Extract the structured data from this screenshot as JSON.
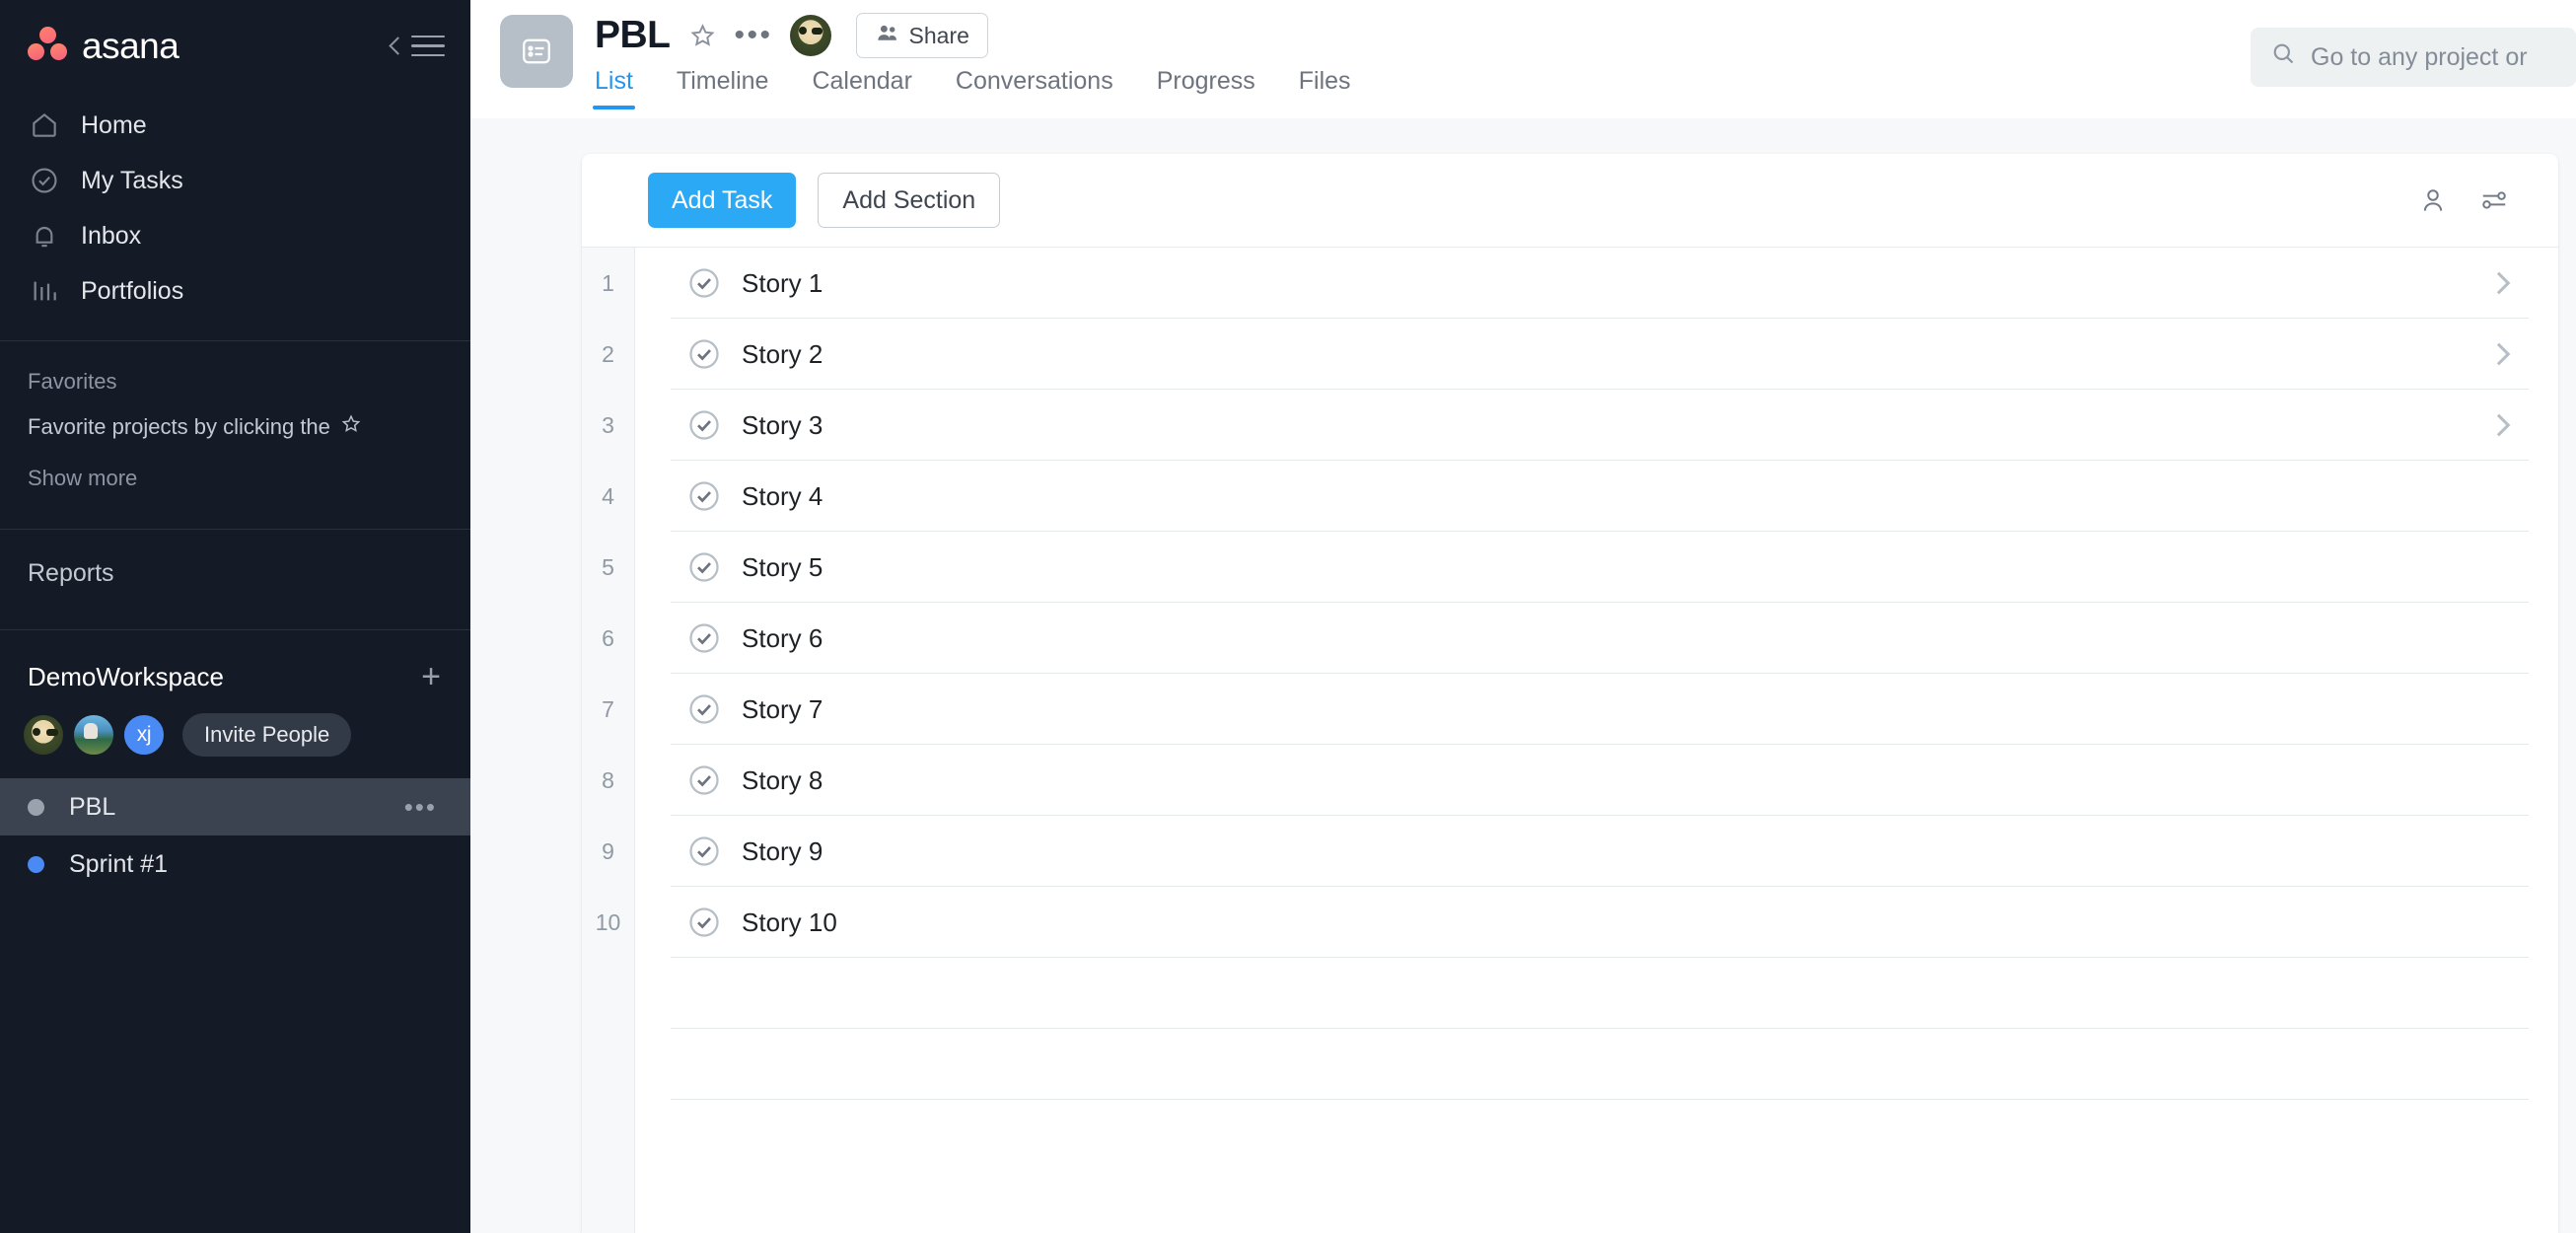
{
  "brand": {
    "name": "asana",
    "logo_icon": "asana-logo-icon"
  },
  "sidebar": {
    "collapse_icon": "chevron-left-icon",
    "menu_icon": "hamburger-menu-icon",
    "nav": [
      {
        "label": "Home",
        "icon": "home-icon"
      },
      {
        "label": "My Tasks",
        "icon": "check-circle-icon"
      },
      {
        "label": "Inbox",
        "icon": "bell-icon"
      },
      {
        "label": "Portfolios",
        "icon": "bar-chart-icon"
      }
    ],
    "favorites": {
      "title": "Favorites",
      "hint": "Favorite projects by clicking the",
      "hint_icon": "star-outline-icon",
      "show_more": "Show more"
    },
    "reports": {
      "title": "Reports"
    },
    "workspace": {
      "name": "DemoWorkspace",
      "add_icon": "plus-icon",
      "members": [
        {
          "name": "member-avatar-octocat",
          "type": "image",
          "initials": ""
        },
        {
          "name": "member-avatar-photo",
          "type": "image",
          "initials": ""
        },
        {
          "name": "member-avatar-initials",
          "type": "initials",
          "initials": "xj",
          "color": "#4a8af4"
        }
      ],
      "invite_label": "Invite People",
      "projects": [
        {
          "label": "PBL",
          "color": "#9aa3ad",
          "active": true,
          "menu_icon": "more-horizontal-icon"
        },
        {
          "label": "Sprint #1",
          "color": "#4a8af4",
          "active": false,
          "menu_icon": ""
        }
      ]
    }
  },
  "header": {
    "project_icon": "list-project-icon",
    "title": "PBL",
    "star_icon": "star-outline-icon",
    "more_icon": "more-horizontal-icon",
    "owner_avatar": "owner-avatar-octocat",
    "share_label": "Share",
    "share_icon": "people-icon",
    "tabs": [
      {
        "label": "List",
        "active": true
      },
      {
        "label": "Timeline",
        "active": false
      },
      {
        "label": "Calendar",
        "active": false
      },
      {
        "label": "Conversations",
        "active": false
      },
      {
        "label": "Progress",
        "active": false
      },
      {
        "label": "Files",
        "active": false
      }
    ],
    "search": {
      "placeholder": "Go to any project or",
      "icon": "search-icon"
    },
    "accent_color": "#2196f3"
  },
  "toolbar": {
    "add_task_label": "Add Task",
    "add_section_label": "Add Section",
    "assignee_icon": "person-icon",
    "filter_icon": "sliders-icon"
  },
  "task_list": {
    "row_numbers": [
      "1",
      "2",
      "3",
      "4",
      "5",
      "6",
      "7",
      "8",
      "9",
      "10",
      "",
      ""
    ],
    "rows": [
      {
        "number": "1",
        "name": "Story 1",
        "status_icon": "check-circle-icon",
        "has_chevron": true
      },
      {
        "number": "2",
        "name": "Story 2",
        "status_icon": "check-circle-icon",
        "has_chevron": true
      },
      {
        "number": "3",
        "name": "Story 3",
        "status_icon": "check-circle-icon",
        "has_chevron": true
      },
      {
        "number": "4",
        "name": "Story 4",
        "status_icon": "check-circle-icon",
        "has_chevron": false
      },
      {
        "number": "5",
        "name": "Story 5",
        "status_icon": "check-circle-icon",
        "has_chevron": false
      },
      {
        "number": "6",
        "name": "Story 6",
        "status_icon": "check-circle-icon",
        "has_chevron": false
      },
      {
        "number": "7",
        "name": "Story 7",
        "status_icon": "check-circle-icon",
        "has_chevron": false
      },
      {
        "number": "8",
        "name": "Story 8",
        "status_icon": "check-circle-icon",
        "has_chevron": false
      },
      {
        "number": "9",
        "name": "Story 9",
        "status_icon": "check-circle-icon",
        "has_chevron": false
      },
      {
        "number": "10",
        "name": "Story 10",
        "status_icon": "check-circle-icon",
        "has_chevron": false
      },
      {
        "number": "",
        "name": "",
        "status_icon": "",
        "has_chevron": false
      },
      {
        "number": "",
        "name": "",
        "status_icon": "",
        "has_chevron": false
      }
    ]
  }
}
